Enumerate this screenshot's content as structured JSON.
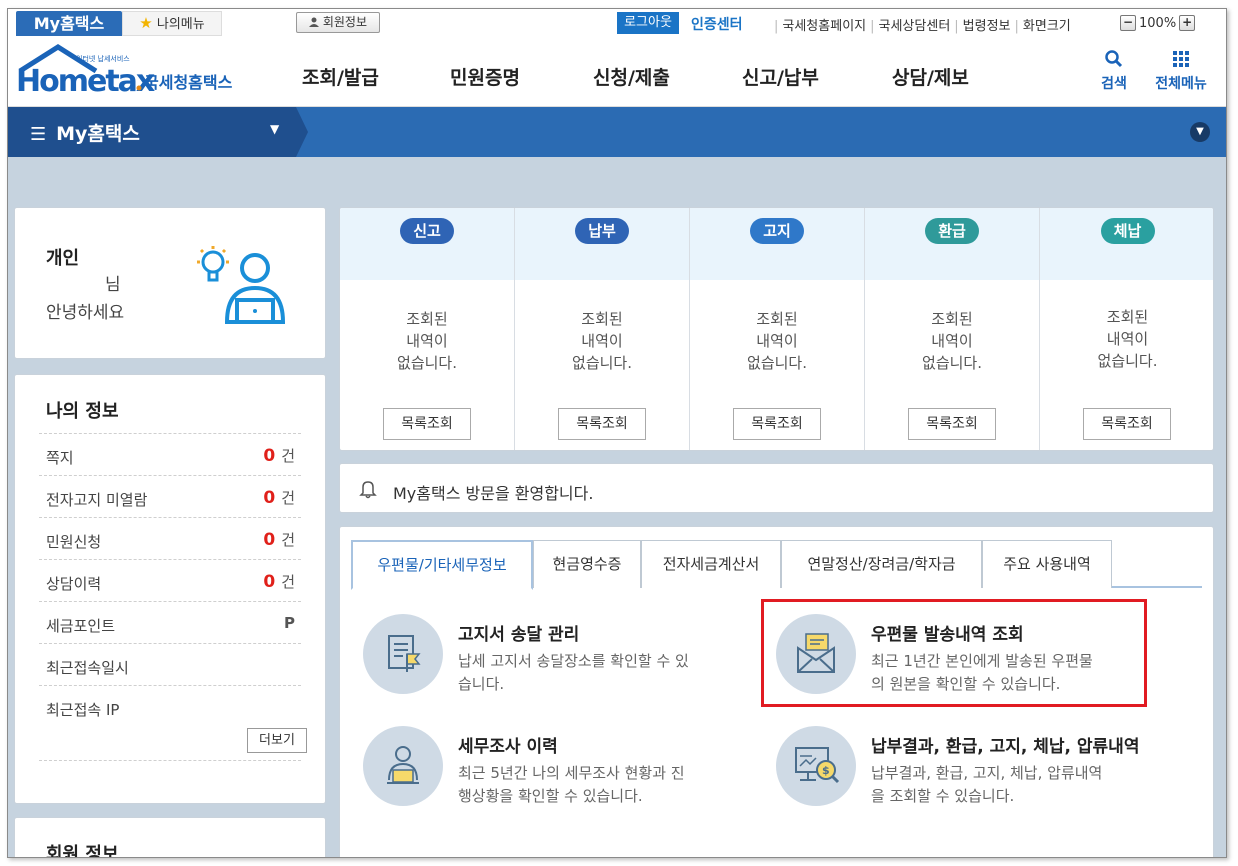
{
  "topbar": {
    "my_tab": "My홈택스",
    "my_menu": "나의메뉴",
    "member_info": "회원정보",
    "logout": "로그아웃",
    "cert_center": "인증센터",
    "links": [
      "국세청홈페이지",
      "국세상담센터",
      "법령정보",
      "화면크기"
    ],
    "zoom": "100%",
    "zoom_minus": "−",
    "zoom_plus": "+"
  },
  "header": {
    "logo_small": "인터넷 납세서비스",
    "logo_main": "Hometax",
    "logo_sub": "국세청홈택스",
    "nav": [
      "조회/발급",
      "민원증명",
      "신청/제출",
      "신고/납부",
      "상담/제보"
    ],
    "search": "검색",
    "all_menu": "전체메뉴"
  },
  "band": {
    "title": "My홈택스"
  },
  "user": {
    "type": "개인",
    "nim": "님",
    "hello": "안녕하세요"
  },
  "info": {
    "title": "나의 정보",
    "rows": [
      {
        "label": "쪽지",
        "count": "0",
        "unit": "건"
      },
      {
        "label": "전자고지 미열람",
        "count": "0",
        "unit": "건"
      },
      {
        "label": "민원신청",
        "count": "0",
        "unit": "건"
      },
      {
        "label": "상담이력",
        "count": "0",
        "unit": "건"
      },
      {
        "label": "세금포인트",
        "count": "",
        "unit": "P"
      },
      {
        "label": "최근접속일시",
        "count": "",
        "unit": ""
      },
      {
        "label": "최근접속 IP",
        "count": "",
        "unit": ""
      }
    ],
    "more": "더보기"
  },
  "member": {
    "title": "회원 정보"
  },
  "status": {
    "columns": [
      {
        "badge": "신고",
        "color": "#2f64b5",
        "msg1": "조회된",
        "msg2": "내역이",
        "msg3": "없습니다.",
        "button": "목록조회"
      },
      {
        "badge": "납부",
        "color": "#2f64b5",
        "msg1": "조회된",
        "msg2": "내역이",
        "msg3": "없습니다.",
        "button": "목록조회"
      },
      {
        "badge": "고지",
        "color": "#2f78c9",
        "msg1": "조회된",
        "msg2": "내역이",
        "msg3": "없습니다.",
        "button": "목록조회"
      },
      {
        "badge": "환급",
        "color": "#2f9a9a",
        "msg1": "조회된",
        "msg2": "내역이",
        "msg3": "없습니다.",
        "button": "목록조회"
      },
      {
        "badge": "체납",
        "color": "#2aa0a0",
        "msg1": "조회된",
        "msg2": "내역이",
        "msg3": "없습니다.",
        "button": "목록조회"
      }
    ]
  },
  "welcome": {
    "text": "My홈택스 방문을 환영합니다."
  },
  "services": {
    "tabs": [
      "우편물/기타세무정보",
      "현금영수증",
      "전자세금계산서",
      "연말정산/장려금/학자금",
      "주요 사용내역"
    ],
    "items": [
      {
        "title": "고지서 송달 관리",
        "desc1": "납세 고지서 송달장소를 확인할 수 있",
        "desc2": "습니다."
      },
      {
        "title": "우편물 발송내역 조회",
        "desc1": "최근 1년간 본인에게 발송된 우편물",
        "desc2": "의 원본을 확인할 수 있습니다."
      },
      {
        "title": "세무조사 이력",
        "desc1": "최근 5년간 나의 세무조사 현황과 진",
        "desc2": "행상황을 확인할 수 있습니다."
      },
      {
        "title": "납부결과, 환급, 고지, 체납, 압류내역",
        "desc1": "납부결과, 환급, 고지, 체납, 압류내역",
        "desc2": "을 조회할 수 있습니다."
      }
    ]
  },
  "colors": {
    "brand_blue": "#1a63b8",
    "band_dark": "#1f4f8e",
    "band": "#2b6bb3",
    "highlight_red": "#e11b22",
    "count_red": "#e0201a"
  }
}
